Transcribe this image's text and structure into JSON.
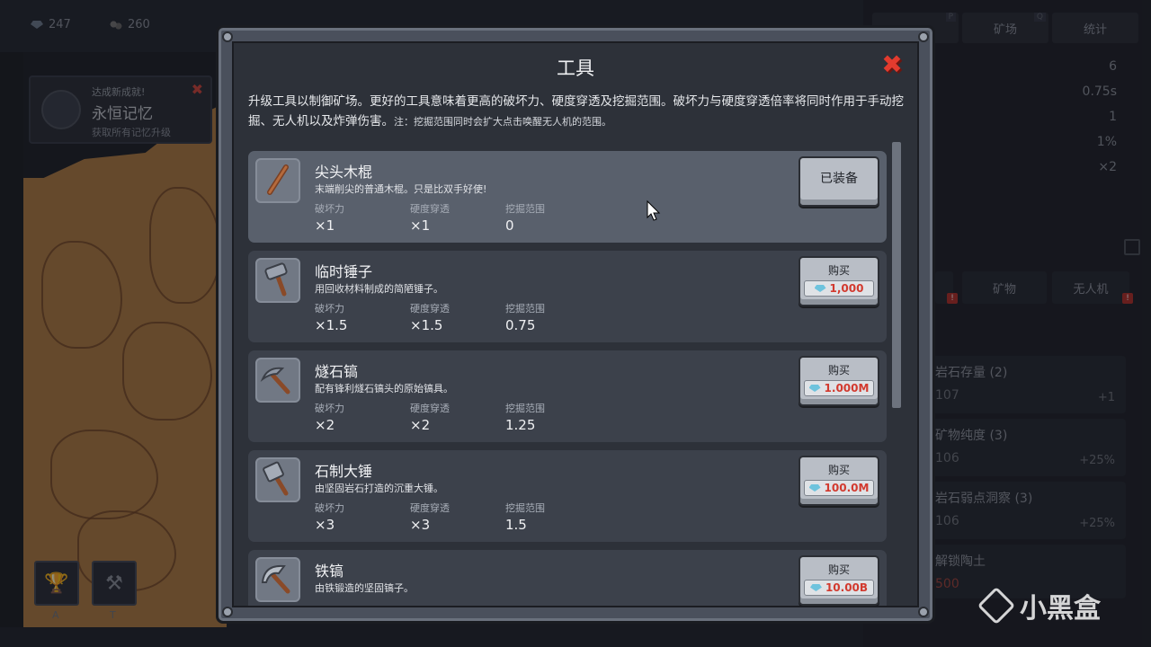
{
  "resources": {
    "gems": "247",
    "ore": "260"
  },
  "achievement": {
    "header": "达成新成就!",
    "name": "永恒记忆",
    "desc": "获取所有记忆升级",
    "close": "✖"
  },
  "bottom_buttons": [
    {
      "key": "A",
      "icon": "trophy-icon"
    },
    {
      "key": "T",
      "icon": "crossed-tools-icon"
    }
  ],
  "right_panel": {
    "top_tabs": [
      {
        "label": "",
        "key": "P"
      },
      {
        "label": "矿场",
        "key": "Q"
      },
      {
        "label": "统计",
        "key": ""
      }
    ],
    "stats": [
      "6",
      "0.75s",
      "1",
      "1%",
      "×2"
    ],
    "mid_tabs": [
      {
        "label": "",
        "key": "U"
      },
      {
        "label": "矿物",
        "key": "R"
      },
      {
        "label": "无人机",
        "key": "D"
      }
    ],
    "alert_mark": "!",
    "upgrades": [
      {
        "name": "岩石存量 (2)",
        "cost": "107",
        "bonus": "+1"
      },
      {
        "name": "矿物纯度 (3)",
        "cost": "106",
        "bonus": "+25%"
      },
      {
        "name": "岩石弱点洞察 (3)",
        "cost": "106",
        "bonus": "+25%"
      },
      {
        "name": "解锁陶土",
        "cost": "500",
        "bonus": ""
      }
    ]
  },
  "watermark": "小黑盒",
  "modal": {
    "title": "工具",
    "close_icon": "✖",
    "description": "升级工具以制御矿场。更好的工具意味着更高的破坏力、硬度穿透及挖掘范围。破坏力与硬度穿透倍率将同时作用于手动挖掘、无人机以及炸弹伤害。",
    "note": "注：挖掘范围同时会扩大点击唤醒无人机的范围。",
    "stat_labels": {
      "power": "破坏力",
      "pierce": "硬度穿透",
      "range": "挖掘范围"
    },
    "tools": [
      {
        "name": "尖头木棍",
        "desc": "末端削尖的普通木棍。只是比双手好使!",
        "power": "×1",
        "pierce": "×1",
        "range": "0",
        "equipped": true,
        "button": "已装备",
        "price": "",
        "icon": "stick-icon"
      },
      {
        "name": "临时锤子",
        "desc": "用回收材料制成的简陋锤子。",
        "power": "×1.5",
        "pierce": "×1.5",
        "range": "0.75",
        "equipped": false,
        "button": "购买",
        "price": "1,000",
        "icon": "makeshift-hammer-icon"
      },
      {
        "name": "燧石镐",
        "desc": "配有锋利燧石镐头的原始镐具。",
        "power": "×2",
        "pierce": "×2",
        "range": "1.25",
        "equipped": false,
        "button": "购买",
        "price": "1.000M",
        "icon": "flint-pickaxe-icon"
      },
      {
        "name": "石制大锤",
        "desc": "由坚固岩石打造的沉重大锤。",
        "power": "×3",
        "pierce": "×3",
        "range": "1.5",
        "equipped": false,
        "button": "购买",
        "price": "100.0M",
        "icon": "stone-sledgehammer-icon"
      },
      {
        "name": "铁镐",
        "desc": "由铁锻造的坚固镐子。",
        "power": "",
        "pierce": "",
        "range": "",
        "equipped": false,
        "button": "购买",
        "price": "10.00B",
        "icon": "iron-pickaxe-icon"
      }
    ]
  },
  "colors": {
    "price_red": "#d23a2f",
    "close_red": "#e23b2e",
    "gem_blue": "#6ec3dd"
  }
}
